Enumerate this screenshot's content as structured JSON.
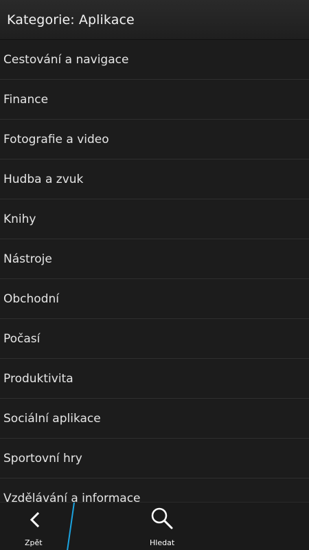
{
  "header": {
    "title": "Kategorie: Aplikace"
  },
  "categories": [
    {
      "label": "Cestování a navigace"
    },
    {
      "label": "Finance"
    },
    {
      "label": "Fotografie a video"
    },
    {
      "label": "Hudba a zvuk"
    },
    {
      "label": "Knihy"
    },
    {
      "label": "Nástroje"
    },
    {
      "label": "Obchodní"
    },
    {
      "label": "Počasí"
    },
    {
      "label": "Produktivita"
    },
    {
      "label": "Sociální aplikace"
    },
    {
      "label": "Sportovní hry"
    },
    {
      "label": "Vzdělávání a informace"
    }
  ],
  "action_bar": {
    "back_label": "Zpět",
    "back_icon": "chevron-left-icon",
    "search_label": "Hledat",
    "search_icon": "magnifier-icon",
    "accent_color": "#1aa3e0"
  }
}
